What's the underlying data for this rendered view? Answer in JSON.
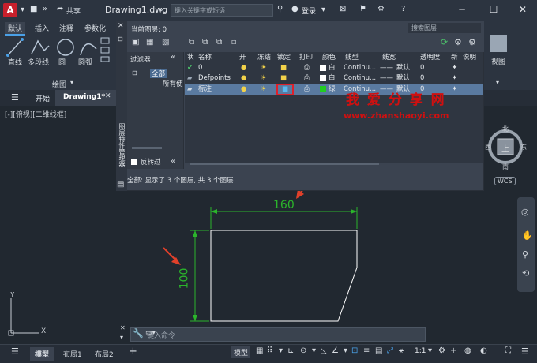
{
  "titlebar": {
    "logo": "A",
    "share": "共享",
    "title": "Drawing1.dwg",
    "search_placeholder": "键入关键字或短语",
    "login": "登录"
  },
  "ribbon": {
    "tabs": [
      "默认",
      "插入",
      "注释",
      "参数化"
    ],
    "tools": [
      "直线",
      "多段线",
      "圆",
      "圆弧"
    ],
    "panel_label": "绘图"
  },
  "doc_tabs": {
    "start": "开始",
    "drawing": "Drawing1*"
  },
  "view_label": "[-][俯视][二维线框]",
  "layer_manager": {
    "current_layer": "当前图层: 0",
    "search_placeholder": "搜索图层",
    "side_title": "图层特性管理器",
    "filter_label": "过滤器",
    "filter_all": "全部",
    "filter_used": "所有使",
    "invert": "反转过",
    "columns": [
      "状",
      "名称",
      "开",
      "冻结",
      "锁定",
      "打印",
      "颜色",
      "线型",
      "线宽",
      "透明度",
      "新",
      "说明"
    ],
    "rows": [
      {
        "name": "0",
        "color": "白",
        "linetype": "Continu...",
        "lineweight": "默认",
        "transparency": "0"
      },
      {
        "name": "Defpoints",
        "color": "白",
        "linetype": "Continu...",
        "lineweight": "默认",
        "transparency": "0"
      },
      {
        "name": "标注",
        "color": "绿",
        "linetype": "Continu...",
        "lineweight": "默认",
        "transparency": "0"
      }
    ],
    "status": "全部: 显示了 3 个图层, 共 3 个图层"
  },
  "watermark": {
    "title": "我 爱 分 享 网",
    "url": "www.zhanshaoyi.com"
  },
  "drawing": {
    "dim_h": "160",
    "dim_v": "100"
  },
  "viewcube": {
    "north": "北",
    "south": "南",
    "east": "东",
    "west": "西",
    "top": "上",
    "wcs": "WCS"
  },
  "right_panel": {
    "view": "视图"
  },
  "command": {
    "placeholder": "键入命令"
  },
  "statusbar": {
    "tabs": [
      "模型",
      "布局1",
      "布局2"
    ],
    "model": "模型",
    "scale": "1:1"
  },
  "colors": {
    "accent": "#4aa0e6",
    "dimension": "#2bb52b",
    "arrow": "#e0402a",
    "highlight": "#e0202a"
  }
}
